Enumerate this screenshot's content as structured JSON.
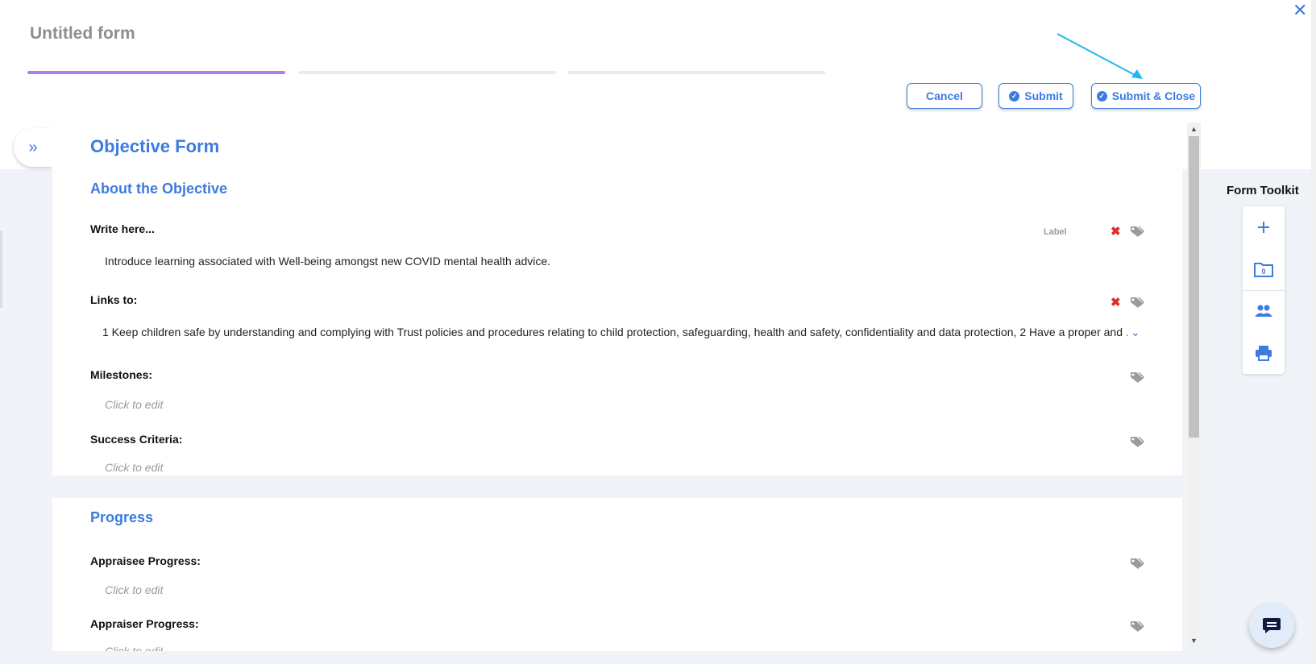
{
  "form": {
    "title": "Untitled form"
  },
  "header": {
    "cancel_label": "Cancel",
    "submit_label": "Submit",
    "submit_close_label": "Submit & Close",
    "close_glyph": "✕"
  },
  "main": {
    "title": "Objective Form",
    "section_about": "About the Objective",
    "fields": {
      "write_here": {
        "label": "Write here...",
        "chip": "Label",
        "value": "Introduce learning associated with Well-being amongst new COVID mental health advice."
      },
      "links_to": {
        "label": "Links to:",
        "value": "1 Keep children safe by understanding and complying with Trust policies and procedures relating to child protection, safeguarding, health and safety, confidentiality and data protection, 2 Have a proper and ..."
      },
      "milestones": {
        "label": "Milestones:",
        "placeholder": "Click to edit"
      },
      "success_criteria": {
        "label": "Success Criteria:",
        "placeholder": "Click to edit"
      }
    },
    "progress": {
      "title": "Progress",
      "appraisee": {
        "label": "Appraisee Progress:",
        "placeholder": "Click to edit"
      },
      "appraiser": {
        "label": "Appraiser Progress:",
        "placeholder": "Click to edit"
      }
    }
  },
  "toolkit": {
    "title": "Form Toolkit",
    "folder_count": "0",
    "icons": [
      "plus-icon",
      "folder-icon",
      "people-icon",
      "printer-icon"
    ]
  },
  "colors": {
    "accent": "#3d7be0",
    "step_active": "#b17ce8",
    "delete": "#e02d2d",
    "background": "#f0f4f9"
  }
}
